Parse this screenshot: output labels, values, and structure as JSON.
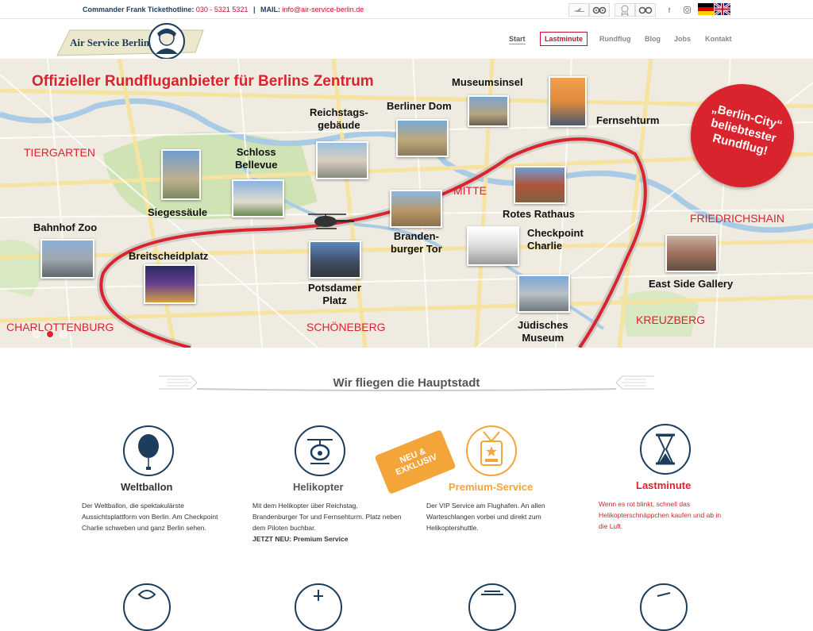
{
  "topbar": {
    "hotline_label": "Commander Frank Tickethotline:",
    "hotline_number": "030 - 5321 5321",
    "mail_label": "MAIL:",
    "mail_address": "info@air-service-berlin.de"
  },
  "header": {
    "logo_text": "Air Service Berlin",
    "nav": [
      "Start",
      "Lastminute",
      "Rundflug",
      "Blog",
      "Jobs",
      "Kontakt"
    ]
  },
  "hero": {
    "title": "Offizieller Rundfluganbieter für Berlins Zentrum",
    "badge_line1": "„Berlin-City“",
    "badge_line2": "beliebtester",
    "badge_line3": "Rundflug!",
    "districts": [
      "TIERGARTEN",
      "MITTE",
      "FRIEDRICHSHAIN",
      "CHARLOTTENBURG",
      "SCHÖNEBERG",
      "KREUZBERG"
    ],
    "landmarks": {
      "museumsinsel": "Museumsinsel",
      "berliner_dom": "Berliner Dom",
      "reichstag_1": "Reichstags-",
      "reichstag_2": "gebäude",
      "fernsehturm": "Fernsehturm",
      "schloss_1": "Schloss",
      "schloss_2": "Bellevue",
      "siegessaeule": "Siegessäule",
      "bahnhof_zoo": "Bahnhof Zoo",
      "breitscheidplatz": "Breitscheidplatz",
      "brandenburger_1": "Branden-",
      "brandenburger_2": "burger Tor",
      "rotes_rathaus": "Rotes Rathaus",
      "checkpoint_1": "Checkpoint",
      "checkpoint_2": "Charlie",
      "east_side": "East Side Gallery",
      "potsdamer_1": "Potsdamer",
      "potsdamer_2": "Platz",
      "juedisches_1": "Jüdisches",
      "juedisches_2": "Museum"
    }
  },
  "section": {
    "title": "Wir fliegen die Hauptstadt"
  },
  "features": [
    {
      "title": "Weltballon",
      "icon": "balloon-icon",
      "text": "Der Weltballon, die spektakulärste Aussichtsplattform von Berlin. Am Checkpoint Charlie schweben und ganz Berlin sehen.",
      "extra": ""
    },
    {
      "title": "Helikopter",
      "icon": "helicopter-icon",
      "text": "Mit dem Helikopter über Reichstag, Brandenburger Tor und Fernsehturm. Platz neben dem Piloten buchbar.",
      "extra": "JETZT NEU: Premium Service"
    },
    {
      "title": "Premium-Service",
      "icon": "vip-pass-icon",
      "text": "Der VIP Service am Flughafen. An allen Warteschlangen vorbei und direkt zum Helikoptershuttle.",
      "extra": ""
    },
    {
      "title": "Lastminute",
      "icon": "hourglass-icon",
      "text": "Wenn es rot blinkt, schnell das Helikopterschnäppchen kaufen und ab in die Luft.",
      "extra": ""
    }
  ],
  "ribbon": {
    "line1": "NEU &",
    "line2": "EXKLUSIV"
  },
  "colors": {
    "brand_navy": "#1d3d5c",
    "accent_red": "#d9232d",
    "premium_orange": "#f4a53a"
  }
}
